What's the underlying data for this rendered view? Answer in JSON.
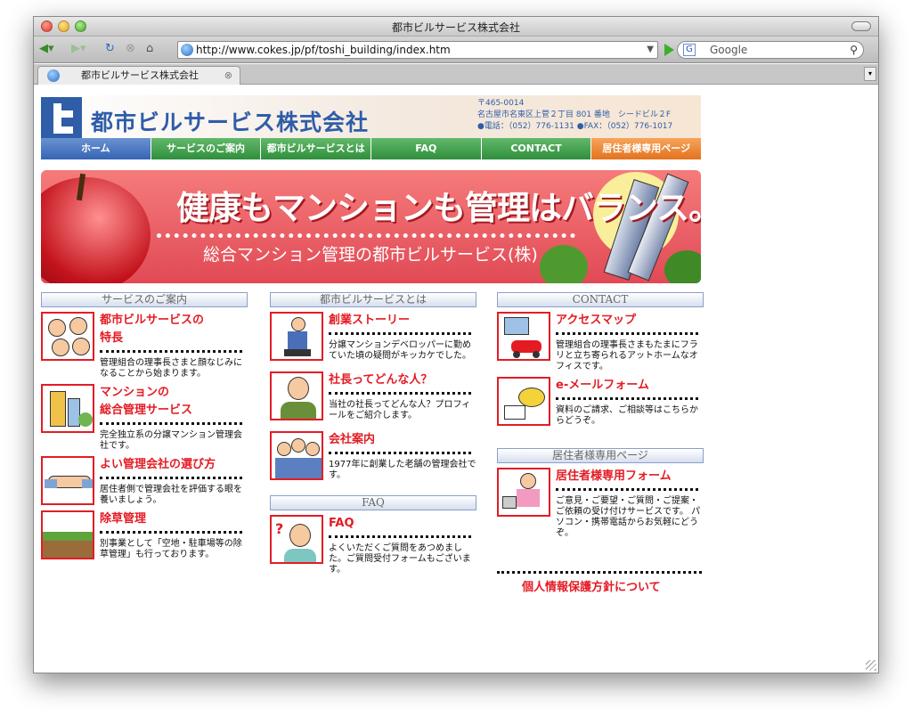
{
  "window": {
    "title": "都市ビルサービス株式会社"
  },
  "toolbar": {
    "url": "http://www.cokes.jp/pf/toshi_building/index.htm",
    "search_placeholder": "Google"
  },
  "tabs": [
    {
      "label": "都市ビルサービス株式会社"
    }
  ],
  "header": {
    "company": "都市ビルサービス株式会社",
    "address_lines": [
      "〒465-0014",
      "名古屋市名東区上菅２丁目 801 番地　シードビル２F",
      "●電話：（052）776-1131 ●FAX：（052）776-1017"
    ]
  },
  "nav": [
    {
      "label": "ホーム",
      "style": "blue"
    },
    {
      "label": "サービスのご案内",
      "style": "green"
    },
    {
      "label": "都市ビルサービスとは",
      "style": "green"
    },
    {
      "label": "FAQ",
      "style": "green"
    },
    {
      "label": "CONTACT",
      "style": "green"
    },
    {
      "label": "居住者様専用ページ",
      "style": "orange"
    }
  ],
  "hero": {
    "catch": "健康もマンションも管理はバランス。",
    "sub": "総合マンション管理の都市ビルサービス(株)"
  },
  "columns": {
    "services": {
      "heading": "サービスのご案内",
      "items": [
        {
          "title1": "都市ビルサービスの",
          "title2": "特長",
          "desc": "管理組合の理事長さまと顔なじみになることから始まります。"
        },
        {
          "title1": "マンションの",
          "title2": "総合管理サービス",
          "desc": "完全独立系の分譲マンション管理会社です。"
        },
        {
          "title1": "よい管理会社の選び方",
          "title2": "",
          "desc": "居住者側で管理会社を評価する眼を養いましょう。"
        },
        {
          "title1": "除草管理",
          "title2": "",
          "desc": "別事業として「空地・駐車場等の除草管理」も行っております。"
        }
      ]
    },
    "about": {
      "heading": "都市ビルサービスとは",
      "items": [
        {
          "title1": "創業ストーリー",
          "title2": "",
          "desc": "分譲マンションデベロッパーに勤めていた頃の疑問がキッカケでした。"
        },
        {
          "title1": "社長ってどんな人？",
          "title2": "",
          "desc": "当社の社長ってどんな人？プロフィールをご紹介します。"
        },
        {
          "title1": "会社案内",
          "title2": "",
          "desc": "1977年に創業した老舗の管理会社です。"
        }
      ]
    },
    "faq": {
      "heading": "FAQ",
      "items": [
        {
          "title1": "FAQ",
          "title2": "",
          "desc": "よくいただくご質問をあつめました。ご質問受付フォームもございます。"
        }
      ]
    },
    "contact": {
      "heading": "CONTACT",
      "items": [
        {
          "title1": "アクセスマップ",
          "title2": "",
          "desc": "管理組合の理事長さまもたまにフラリと立ち寄られるアットホームなオフィスです。"
        },
        {
          "title1": "e-メールフォーム",
          "title2": "",
          "desc": "資料のご請求、ご相談等はこちらからどうぞ。"
        }
      ]
    },
    "residents": {
      "heading": "居住者様専用ページ",
      "items": [
        {
          "title1": "居住者様専用フォーム",
          "title2": "",
          "desc": "ご意見・ご要望・ご質問・ご提案・ご依頼の受け付けサービスです。 パソコン・携帯電話からお気軽にどうぞ。"
        }
      ]
    }
  },
  "privacy_link": "個人情報保護方針について",
  "colors": {
    "accent_red": "#e41b23",
    "brand_blue": "#2f5da8"
  }
}
